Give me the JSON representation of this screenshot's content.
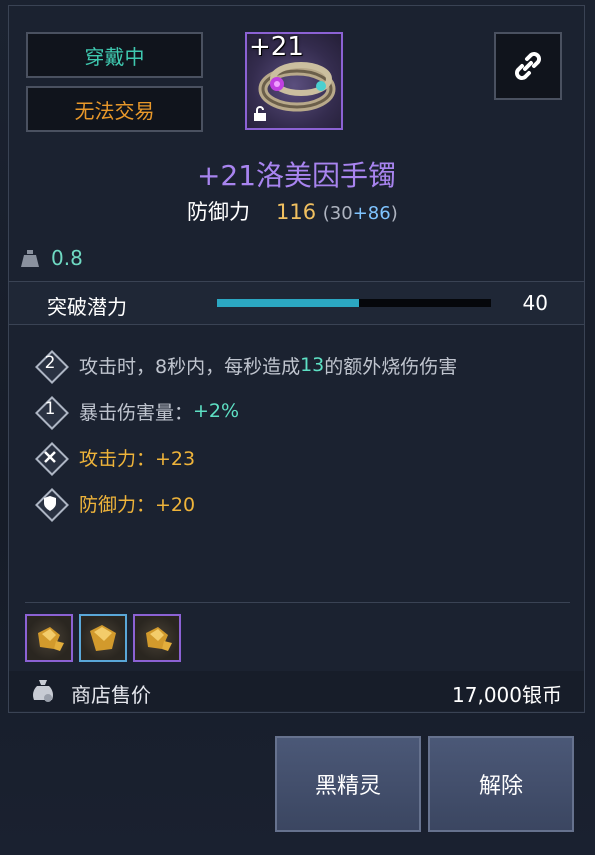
{
  "tags": {
    "equipped": "穿戴中",
    "no_trade": "无法交易"
  },
  "item": {
    "enhance_level": "+21",
    "name": "+21洛美因手镯",
    "stat_label": "防御力",
    "stat_value": "116",
    "stat_paren_open": "(30",
    "stat_bonus": "+86",
    "stat_paren_close": ")",
    "weight": "0.8"
  },
  "breakthrough": {
    "label": "突破潜力",
    "value": "40",
    "fill_fraction": 0.52
  },
  "effects": [
    {
      "badge": "2",
      "pre": "攻击时，8秒内，每秒造成",
      "highlight": "13",
      "post": "的额外烧伤伤害"
    },
    {
      "badge": "1",
      "pre": "暴击伤害量：",
      "highlight": "+2%"
    },
    {
      "icon": "crossed-swords-icon",
      "text": "攻击力：+23"
    },
    {
      "icon": "shield-icon",
      "text": "防御力：+20"
    }
  ],
  "sell": {
    "label": "商店售价",
    "price": "17,000银币"
  },
  "buttons": {
    "dark_elf": "黑精灵",
    "release": "解除"
  },
  "colors": {
    "equipped_text": "#3fc9b0",
    "no_trade_text": "#e8982a",
    "item_name": "#a884ef",
    "stat_value": "#f0c060",
    "highlight": "#5ee0c4",
    "gold_effect": "#efb43a",
    "bar_fill": "#2ba7c2"
  }
}
